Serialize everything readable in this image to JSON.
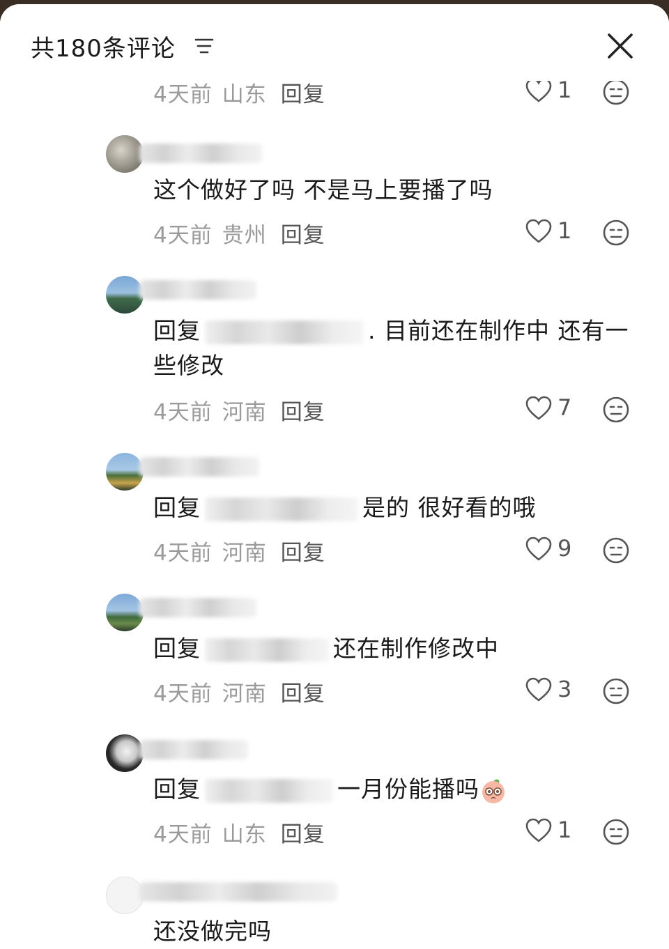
{
  "header": {
    "title": "共180条评论"
  },
  "comments": [
    {
      "time": "4天前",
      "region": "山东",
      "reply": "回复",
      "likes": "1",
      "text": ""
    },
    {
      "time": "4天前",
      "region": "贵州",
      "reply": "回复",
      "likes": "1",
      "text": "这个做好了吗 不是马上要播了吗"
    },
    {
      "time": "4天前",
      "region": "河南",
      "reply": "回复",
      "likes": "7",
      "reply_prefix": "回复",
      "text": ". 目前还在制作中 还有一些修改"
    },
    {
      "time": "4天前",
      "region": "河南",
      "reply": "回复",
      "likes": "9",
      "reply_prefix": "回复",
      "text": "是的 很好看的哦"
    },
    {
      "time": "4天前",
      "region": "河南",
      "reply": "回复",
      "likes": "3",
      "reply_prefix": "回复",
      "text": "还在制作修改中"
    },
    {
      "time": "4天前",
      "region": "山东",
      "reply": "回复",
      "likes": "1",
      "reply_prefix": "回复",
      "text": "一月份能播吗"
    },
    {
      "text": "还没做完吗"
    }
  ],
  "icons": {
    "sort": "sort-lines-icon",
    "close": "close-icon",
    "like": "heart-outline-icon",
    "dislike": "neutral-face-icon",
    "emoji": "peach-emoji-icon"
  },
  "colors": {
    "meta": "#9a9a9a",
    "text": "#1a1a1a",
    "background": "#ffffff"
  }
}
